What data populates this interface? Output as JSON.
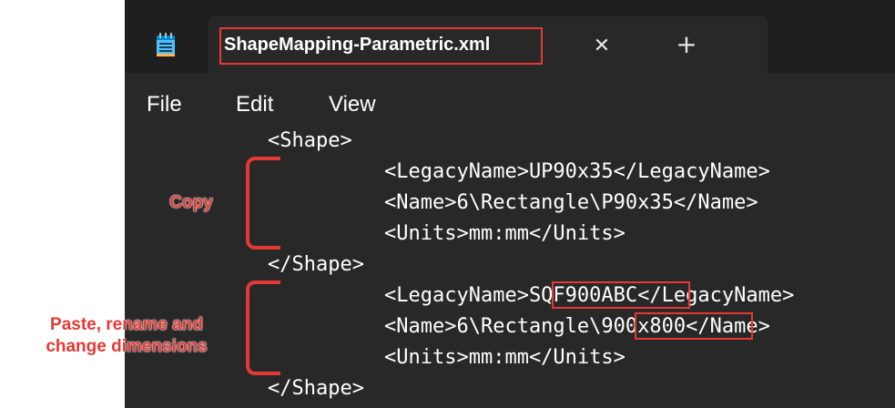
{
  "window": {
    "tab_title": "ShapeMapping-Parametric.xml",
    "close_tab_glyph": "✕",
    "new_tab_glyph": "+"
  },
  "menu": {
    "file": "File",
    "edit": "Edit",
    "view": "View"
  },
  "code": {
    "line1": "<Shape>",
    "line2": "<LegacyName>UP90x35</LegacyName>",
    "line3": "<Name>6\\Rectangle\\P90x35</Name>",
    "line4": "<Units>mm:mm</Units>",
    "line5": "</Shape>",
    "line6": "<LegacyName>SQF900ABC</LegacyName>",
    "line7": "<Name>6\\Rectangle\\900x800</Name>",
    "line8": "<Units>mm:mm</Units>",
    "line9": "</Shape>"
  },
  "annotations": {
    "copy": "Copy",
    "paste_line1": "Paste, rename and",
    "paste_line2": "change dimensions"
  },
  "colors": {
    "accent_red": "#e53935",
    "editor_bg": "#282828",
    "titlebar_bg": "#1f1f1f",
    "text": "#ffffff"
  },
  "icons": {
    "app": "notepad-icon",
    "close": "close-icon",
    "new_tab": "plus-icon"
  }
}
